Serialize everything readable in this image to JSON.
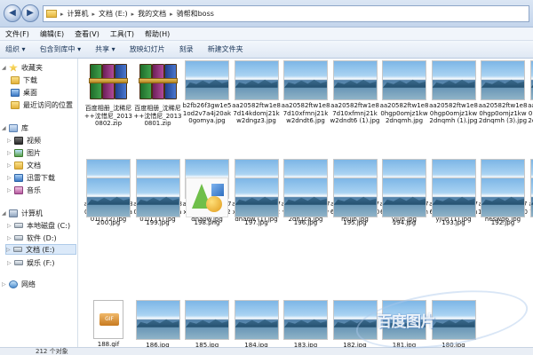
{
  "address": {
    "crumbs": [
      "计算机",
      "文档 (E:)",
      "我的文档",
      "骑帮和boss"
    ]
  },
  "menu": [
    "文件(F)",
    "编辑(E)",
    "查看(V)",
    "工具(T)",
    "帮助(H)"
  ],
  "toolbar": [
    "组织 ▾",
    "包含到库中 ▾",
    "共享 ▾",
    "放映幻灯片",
    "刻录",
    "新建文件夹"
  ],
  "nav": {
    "favorites": "收藏夹",
    "favorite_items": [
      "下载",
      "桌面",
      "最近访问的位置"
    ],
    "libraries": "库",
    "library_items": [
      "视频",
      "图片",
      "文档",
      "迅雷下载",
      "音乐"
    ],
    "computer": "计算机",
    "drives": [
      "本地磁盘 (C:)",
      "软件 (D:)",
      "文档 (E:)",
      "娱乐 (F:)"
    ],
    "network": "网络"
  },
  "files": [
    {
      "name": "百度相册_沈稀尼++沈惜尼_20130802.zip",
      "type": "zip"
    },
    {
      "name": "百度相册_沈稀尼++沈惜尼_20130801.zip",
      "type": "zip"
    },
    {
      "name": "b2fb26f3gw1e51od2v7a4j20ak0gomya.jpg",
      "type": "jpg"
    },
    {
      "name": "aa20582ftw1e87d14kdomj21kw2dngz3.jpg",
      "type": "jpg"
    },
    {
      "name": "aa20582ftw1e87d10xfmnj21kw2dndt6.jpg",
      "type": "jpg"
    },
    {
      "name": "aa20582ftw1e87d10xfmnj21kw2dndt6 (1).jpg",
      "type": "jpg"
    },
    {
      "name": "aa20582ftw1e80hgp0omjz1kw2dnqmh.jpg",
      "type": "jpg"
    },
    {
      "name": "aa20582ftw1e80hgp0omjz1kw2dnqmh (1).jpg",
      "type": "jpg"
    },
    {
      "name": "aa20582ftw1e80hgp0omjz1kw2dnqmh (3).jpg",
      "type": "jpg"
    },
    {
      "name": "aa20582ftw1e80hgp0omjz1kw2dnqmh (2).jpg",
      "type": "jpg"
    },
    {
      "name": "aa20582ftw1e80hglojl5j21j02a01l1 (2).jpg",
      "type": "jpg"
    },
    {
      "name": "aa20582ftw1e80hglojl5j21j02a01l1 (1).jpg",
      "type": "jpg"
    },
    {
      "name": "aa20582ftw1e7xzfq3rlxj21kw2dnaow.jpg",
      "type": "jpg"
    },
    {
      "name": "aa20582ftw1e7xzfq3rlxj21kw2dnaow (1).jpg",
      "type": "jpg"
    },
    {
      "name": "aa20582ftw1e7vusjc83bj21kw2dn1ca.jpg",
      "type": "jpg"
    },
    {
      "name": "aa20582ftw1e76pl99281j20fp0mujb.jpg",
      "type": "jpg"
    },
    {
      "name": "aa20582ftw1e76pl7dr]j20gu0nyjun.jpg",
      "type": "jpg"
    },
    {
      "name": "aa20582ftw1e76pl7dr]j20gu0nyjun (1).jpg",
      "type": "jpg"
    },
    {
      "name": "aa20582ftw1e71z5jd3b2j20dc0h6swg6.jpg",
      "type": "jpg"
    },
    {
      "name": "aa20582fgw1e754yciyk6j21kw27kat9.jpg",
      "type": "jpg"
    },
    {
      "name": "200.jpg",
      "type": "jpg"
    },
    {
      "name": "199.jpg",
      "type": "jpg"
    },
    {
      "name": "198.png",
      "type": "png"
    },
    {
      "name": "197.jpg",
      "type": "jpg"
    },
    {
      "name": "196.jpg",
      "type": "jpg"
    },
    {
      "name": "195.jpg",
      "type": "jpg"
    },
    {
      "name": "194.jpg",
      "type": "jpg"
    },
    {
      "name": "193.jpg",
      "type": "jpg"
    },
    {
      "name": "192.jpg",
      "type": "jpg"
    },
    {
      "name": "189.jpg",
      "type": "jpg"
    },
    {
      "name": "188.gif",
      "type": "gif"
    },
    {
      "name": "186.jpg",
      "type": "jpg"
    },
    {
      "name": "185.jpg",
      "type": "jpg"
    },
    {
      "name": "184.jpg",
      "type": "jpg"
    },
    {
      "name": "183.jpg",
      "type": "jpg"
    },
    {
      "name": "182.jpg",
      "type": "jpg"
    },
    {
      "name": "181.jpg",
      "type": "jpg"
    },
    {
      "name": "180.jpg",
      "type": "jpg"
    }
  ],
  "gif_badge": "GIF",
  "status": "212 个对象",
  "watermark": "百度图片"
}
